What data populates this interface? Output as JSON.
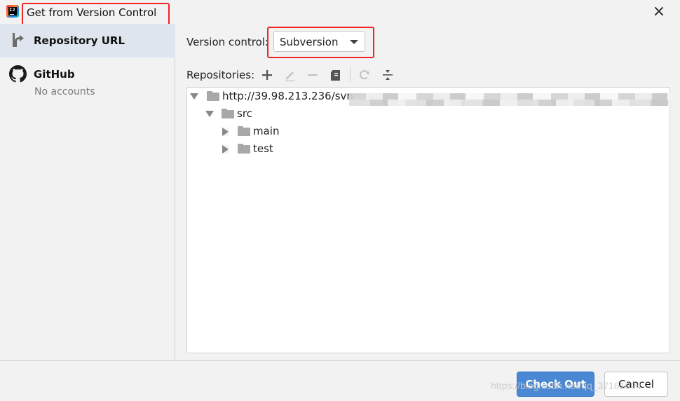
{
  "dialog": {
    "title": "Get from Version Control",
    "close_symbol": "×"
  },
  "sidebar": {
    "items": [
      {
        "label": "Repository URL",
        "icon": "vcs-icon",
        "selected": true
      },
      {
        "label": "GitHub",
        "sub": "No accounts",
        "icon": "github-icon",
        "selected": false
      }
    ]
  },
  "form": {
    "version_control_label": "Version control:",
    "version_control_value": "Subversion",
    "repositories_label": "Repositories:"
  },
  "toolbar": {
    "icons": [
      "add-icon",
      "edit-icon",
      "remove-icon",
      "browse-icon",
      "refresh-icon",
      "collapse-icon"
    ]
  },
  "tree": {
    "nodes": [
      {
        "label": "http://39.98.213.236/svn",
        "expanded": true
      },
      {
        "label": "src",
        "expanded": true
      },
      {
        "label": "main",
        "expanded": false
      },
      {
        "label": "test",
        "expanded": false
      }
    ]
  },
  "buttons": {
    "checkout": "Check Out",
    "cancel": "Cancel"
  },
  "watermark": "https://blog.csdn.net/qq_37161094",
  "colors": {
    "accent": "#4a88d4",
    "selection": "#dfe5ee",
    "highlight_box": "#f02525"
  }
}
